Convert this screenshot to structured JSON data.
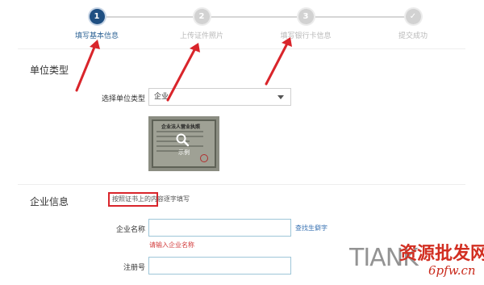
{
  "stepper": {
    "steps": [
      {
        "number": "1",
        "label": "填写基本信息",
        "state": "active"
      },
      {
        "number": "2",
        "label": "上传证件照片",
        "state": "pending"
      },
      {
        "number": "3",
        "label": "填写银行卡信息",
        "state": "pending"
      },
      {
        "number": "✓",
        "label": "提交成功",
        "state": "pending"
      }
    ]
  },
  "unit_section": {
    "title": "单位类型",
    "select_label": "选择单位类型",
    "select_value": "企业",
    "sample_image": {
      "license_title": "企业法人营业执照",
      "zoom_icon": "magnifier-icon",
      "caption": "示例"
    }
  },
  "company_section": {
    "title": "企业信息",
    "hint": "按照证书上的内容逐字填写",
    "name_label": "企业名称",
    "name_value": "",
    "find_char_link": "查找生僻字",
    "name_error": "请输入企业名称",
    "reg_label": "注册号",
    "reg_value": ""
  },
  "watermark": {
    "latin": "TIANK",
    "chinese": "资源批发网",
    "domain": "6pfw.cn"
  },
  "colors": {
    "active_step": "#1f4f82",
    "inactive_step": "#d2d2d2",
    "annotation_red": "#d9252b",
    "link_blue": "#3a73b3",
    "error_red": "#d23b3b"
  }
}
